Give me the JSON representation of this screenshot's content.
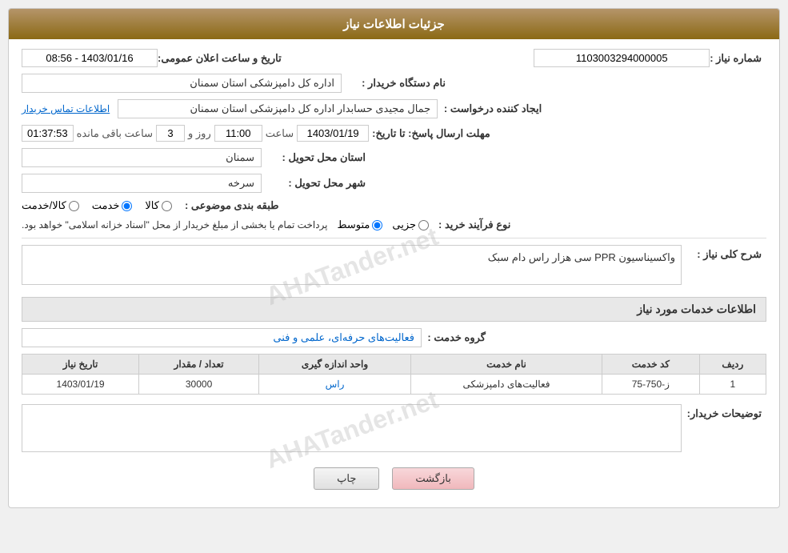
{
  "header": {
    "title": "جزئیات اطلاعات نیاز"
  },
  "fields": {
    "shomara_niaz_label": "شماره نیاز :",
    "shomara_niaz_value": "1103003294000005",
    "name_dasgah_label": "نام دستگاه خریدار :",
    "name_dasgah_value": "اداره کل دامپزشکی استان سمنان",
    "ijad_label": "ایجاد کننده درخواست :",
    "ijad_value": "جمال مجیدی حسابدار اداره کل دامپزشکی استان سمنان",
    "ijad_link": "اطلاعات تماس خریدار",
    "moholat_label": "مهلت ارسال پاسخ: تا تاریخ:",
    "moholat_date": "1403/01/19",
    "moholat_saat_label": "ساعت",
    "moholat_saat": "11:00",
    "moholat_roz_label": "روز و",
    "moholat_roz": "3",
    "moholat_baghimande_label": "ساعت باقی مانده",
    "moholat_baghimande": "01:37:53",
    "ostan_label": "استان محل تحویل :",
    "ostan_value": "سمنان",
    "shahr_label": "شهر محل تحویل :",
    "shahr_value": "سرخه",
    "tabe_label": "طبقه بندی موضوعی :",
    "tabe_kala": "کالا",
    "tabe_khadamat": "خدمت",
    "tabe_kala_khadamat": "کالا/خدمت",
    "noue_farayand_label": "نوع فرآیند خرید :",
    "noue_jozi": "جزیی",
    "noue_motovaset": "متوسط",
    "noue_description": "پرداخت تمام یا بخشی از مبلغ خریدار از محل \"اسناد خزانه اسلامی\" خواهد بود.",
    "tarikh_label": "تاریخ و ساعت اعلان عمومی:",
    "tarikh_value": "1403/01/16 - 08:56",
    "sharh_label": "شرح کلی نیاز :",
    "sharh_value": "واکسیناسیون PPR سی هزار راس دام سبک",
    "khadamat_section_title": "اطلاعات خدمات مورد نیاز",
    "grouh_label": "گروه خدمت :",
    "grouh_value": "فعالیت‌های حرفه‌ای، علمی و فنی",
    "table": {
      "headers": [
        "ردیف",
        "کد خدمت",
        "نام خدمت",
        "واحد اندازه گیری",
        "تعداد / مقدار",
        "تاریخ نیاز"
      ],
      "rows": [
        {
          "radif": "1",
          "kod": "ز-750-75",
          "name": "فعالیت‌های دامپزشکی",
          "vahed": "راس",
          "tedad": "30000",
          "tarikh": "1403/01/19"
        }
      ]
    },
    "tozihat_label": "توضیحات خریدار:",
    "tozihat_value": ""
  },
  "buttons": {
    "chap": "چاپ",
    "bazgasht": "بازگشت"
  },
  "watermark": "AHATander.net"
}
